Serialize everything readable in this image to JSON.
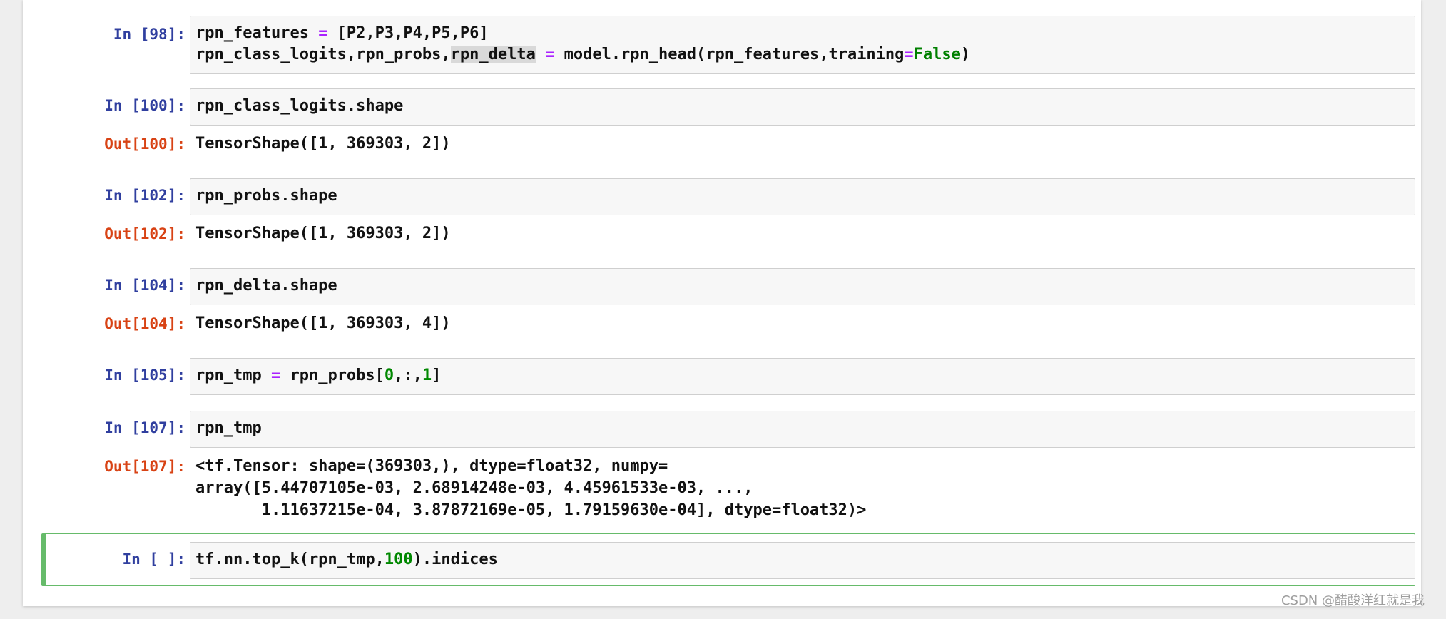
{
  "cells": [
    {
      "in_prompt": "In [98]:",
      "code_line1": {
        "a": "rpn_features ",
        "op": "=",
        "b": " [P2,P3,P4,P5,P6]"
      },
      "code_line2": {
        "a": "rpn_class_logits,rpn_probs,",
        "hl": "rpn_delta",
        "b": " ",
        "op": "=",
        "c": " model.rpn_head(rpn_features,training",
        "op2": "=",
        "kw": "False",
        "d": ")"
      }
    },
    {
      "in_prompt": "In [100]:",
      "code": "rpn_class_logits.shape",
      "out_prompt": "Out[100]:",
      "output": "TensorShape([1, 369303, 2])"
    },
    {
      "in_prompt": "In [102]:",
      "code": "rpn_probs.shape",
      "out_prompt": "Out[102]:",
      "output": "TensorShape([1, 369303, 2])"
    },
    {
      "in_prompt": "In [104]:",
      "code": "rpn_delta.shape",
      "out_prompt": "Out[104]:",
      "output": "TensorShape([1, 369303, 4])"
    },
    {
      "in_prompt": "In [105]:",
      "code": {
        "a": "rpn_tmp ",
        "op": "=",
        "b": " rpn_probs[",
        "n0": "0",
        "c": ",:,",
        "n1": "1",
        "d": "]"
      }
    },
    {
      "in_prompt": "In [107]:",
      "code": "rpn_tmp",
      "out_prompt": "Out[107]:",
      "output_lines": [
        "<tf.Tensor: shape=(369303,), dtype=float32, numpy=",
        "array([5.44707105e-03, 2.68914248e-03, 4.45961533e-03, ...,",
        "       1.11637215e-04, 3.87872169e-05, 1.79159630e-04], dtype=float32)>"
      ]
    },
    {
      "in_prompt": "In [ ]:",
      "code": {
        "a": "tf.nn.top_k(rpn_tmp,",
        "n": "100",
        "b": ").indices"
      }
    }
  ],
  "watermark": "CSDN @醋酸洋红就是我",
  "colors": {
    "in_prompt": "#303f9f",
    "out_prompt": "#d84315",
    "operator": "#aa22ff",
    "number": "#008800",
    "selected_border": "#66bb6a"
  }
}
